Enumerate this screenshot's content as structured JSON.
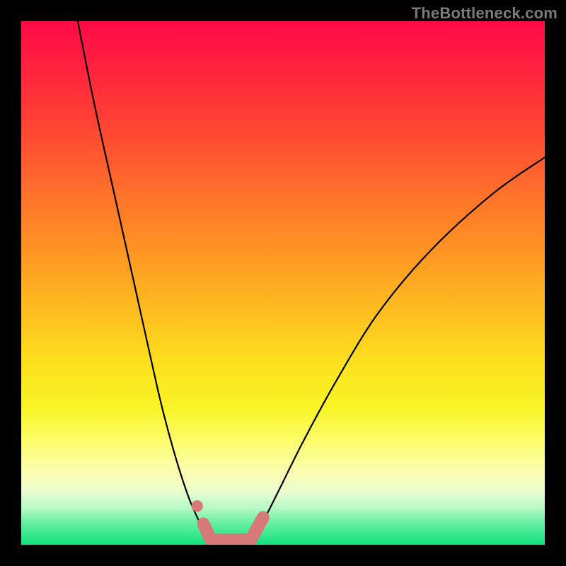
{
  "watermark": "TheBottleneck.com",
  "chart_data": {
    "type": "line",
    "title": "",
    "xlabel": "",
    "ylabel": "",
    "xlim": [
      0,
      100
    ],
    "ylim": [
      0,
      100
    ],
    "grid": false,
    "legend": false,
    "series": [
      {
        "name": "left-branch",
        "x": [
          10.8,
          14,
          18,
          22,
          26,
          28,
          30,
          32,
          33.5,
          35,
          36.2
        ],
        "y": [
          100,
          84,
          66,
          48,
          30,
          22,
          15,
          9,
          5.5,
          2.5,
          0.6
        ]
      },
      {
        "name": "right-branch",
        "x": [
          43.8,
          45,
          47,
          50,
          54,
          60,
          68,
          78,
          90,
          100
        ],
        "y": [
          0.6,
          2.5,
          6,
          12,
          20,
          31,
          44,
          56,
          67,
          74
        ]
      }
    ],
    "flat_bottom": {
      "x_start": 36.2,
      "x_end": 43.8,
      "y": 0.6
    },
    "markers": {
      "name": "highlighted-segment",
      "color": "#d77a77",
      "dot": {
        "x": 33.6,
        "y": 7.4,
        "r": 1.1
      },
      "left_stub": {
        "x": [
          34.8,
          36.2
        ],
        "y": [
          4.0,
          0.9
        ]
      },
      "bottom_bar": {
        "x": [
          36.6,
          43.4
        ],
        "y": [
          0.9,
          0.9
        ]
      },
      "right_stub": {
        "x": [
          43.8,
          46.2
        ],
        "y": [
          0.9,
          5.2
        ]
      }
    },
    "background_gradient": {
      "top": "#ff0b46",
      "mid": "#fce31e",
      "bottom": "#12e27e"
    }
  }
}
